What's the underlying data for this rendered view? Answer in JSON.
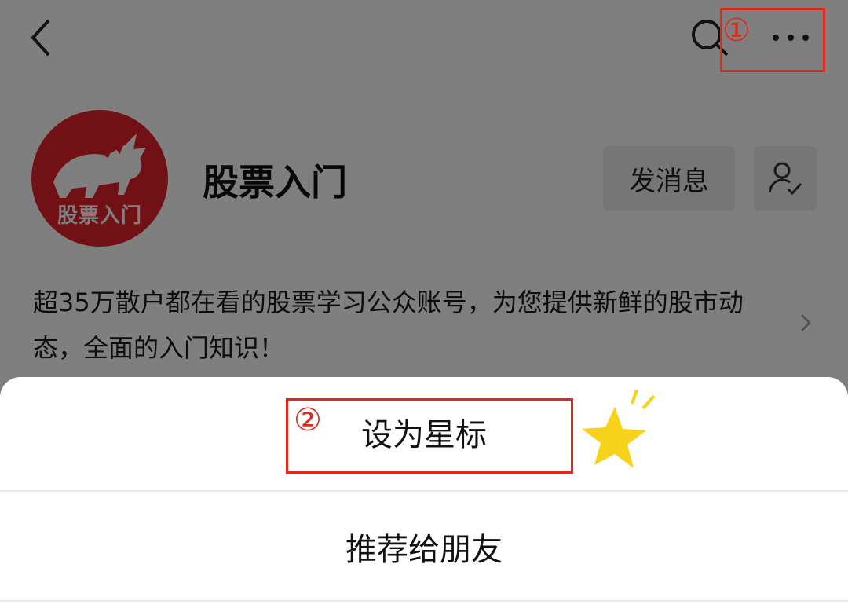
{
  "account": {
    "name": "股票入门",
    "avatar_text": "股票入门",
    "description": "超35万散户都在看的股票学习公众账号，为您提供新鲜的股市动态，全面的入门知识！"
  },
  "header": {
    "back_icon": "back-chevron-icon",
    "search_icon": "search-icon",
    "more_icon": "more-dots-icon"
  },
  "actions": {
    "message_label": "发消息",
    "follow_icon": "person-check-icon"
  },
  "sheet": {
    "items": [
      {
        "label": "设为星标"
      },
      {
        "label": "推荐给朋友"
      }
    ]
  },
  "annotations": {
    "step1": "①",
    "step2": "②"
  },
  "colors": {
    "annotation_red": "#e0281b",
    "avatar_red": "#e2202b",
    "star_yellow": "#f7d11a"
  }
}
